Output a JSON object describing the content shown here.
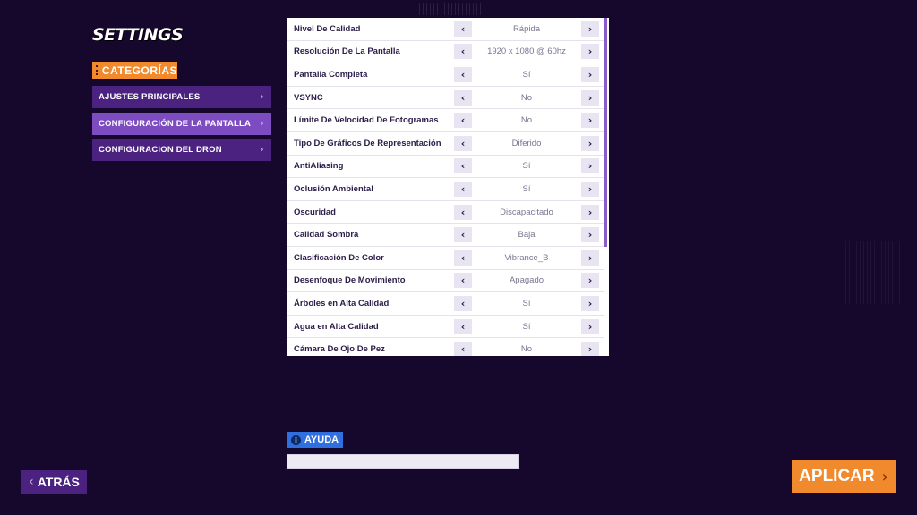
{
  "header": {
    "title": "SETTINGS"
  },
  "categories": {
    "badge_label": "CATEGORÍAS",
    "items": [
      {
        "label": "AJUSTES PRINCIPALES",
        "active": false
      },
      {
        "label": "CONFIGURACIÓN DE LA PANTALLA",
        "active": true
      },
      {
        "label": "CONFIGURACION DEL DRON",
        "active": false
      }
    ]
  },
  "settings": {
    "rows": [
      {
        "name": "Nivel De Calidad",
        "value": "Rápida"
      },
      {
        "name": "Resolución De La Pantalla",
        "value": "1920 x 1080 @ 60hz"
      },
      {
        "name": "Pantalla Completa",
        "value": "Sí"
      },
      {
        "name": "VSYNC",
        "value": "No"
      },
      {
        "name": "Límite De Velocidad De Fotogramas",
        "value": "No"
      },
      {
        "name": "Tipo De Gráficos De Representación",
        "value": "Diferido"
      },
      {
        "name": "AntiAliasing",
        "value": "Sí"
      },
      {
        "name": "Oclusión Ambiental",
        "value": "Sí"
      },
      {
        "name": "Oscuridad",
        "value": "Discapacitado"
      },
      {
        "name": "Calidad Sombra",
        "value": "Baja"
      },
      {
        "name": "Clasificación De Color",
        "value": "Vibrance_B"
      },
      {
        "name": "Desenfoque De Movimiento",
        "value": "Apagado"
      },
      {
        "name": "Árboles en Alta Calidad",
        "value": "Sí"
      },
      {
        "name": "Agua en Alta Calidad",
        "value": "Sí"
      },
      {
        "name": "Cámara De Ojo De Pez",
        "value": "No"
      }
    ],
    "prev_glyph": "‹",
    "next_glyph": "›"
  },
  "help": {
    "label": "AYUDA",
    "icon_glyph": "i",
    "text": ""
  },
  "footer": {
    "back_label": "ATRÁS",
    "back_glyph": "‹",
    "apply_label": "APLICAR",
    "apply_glyph": "›"
  },
  "colors": {
    "background": "#16082d",
    "accent_orange": "#f08a2c",
    "purple_item": "#4b2280",
    "purple_active": "#7d4cc1",
    "help_blue": "#2f6fe0",
    "scroll_thumb": "#8a5cc7"
  },
  "icons": {
    "category_icon": "list-icon",
    "help_icon": "info-icon",
    "chevron": "chevron-right-icon",
    "back": "chevron-left-icon"
  }
}
